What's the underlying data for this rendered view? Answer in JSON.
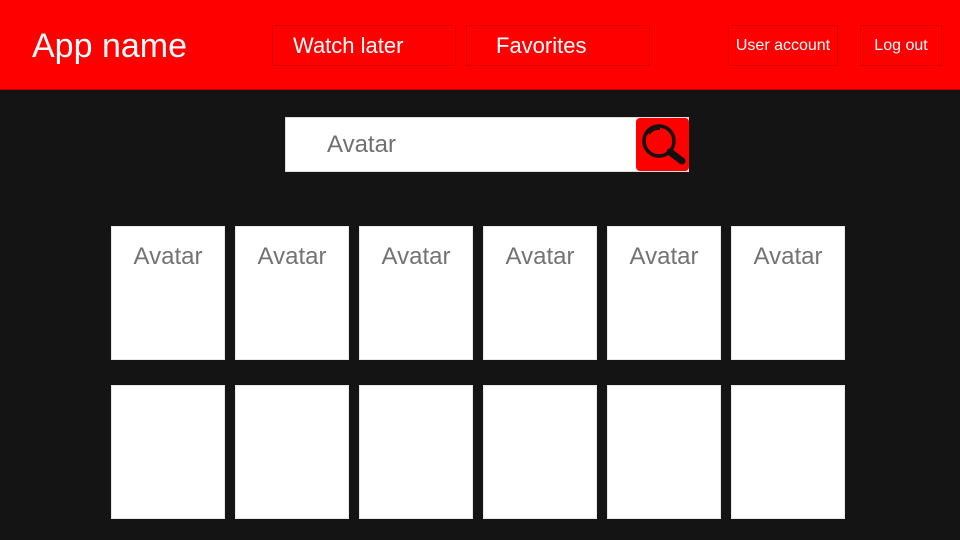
{
  "header": {
    "app_name": "App name",
    "nav": {
      "watch_later": "Watch later",
      "favorites": "Favorites",
      "user_account": "User account",
      "log_out": "Log out"
    }
  },
  "search": {
    "value": "Avatar",
    "button_icon": "magnifier-icon"
  },
  "results": {
    "rows": [
      [
        "Avatar",
        "Avatar",
        "Avatar",
        "Avatar",
        "Avatar",
        "Avatar"
      ],
      [
        "",
        "",
        "",
        "",
        "",
        ""
      ]
    ]
  },
  "colors": {
    "accent": "#ff0000",
    "background": "#141414",
    "card": "#ffffff",
    "muted_text": "#737373"
  }
}
